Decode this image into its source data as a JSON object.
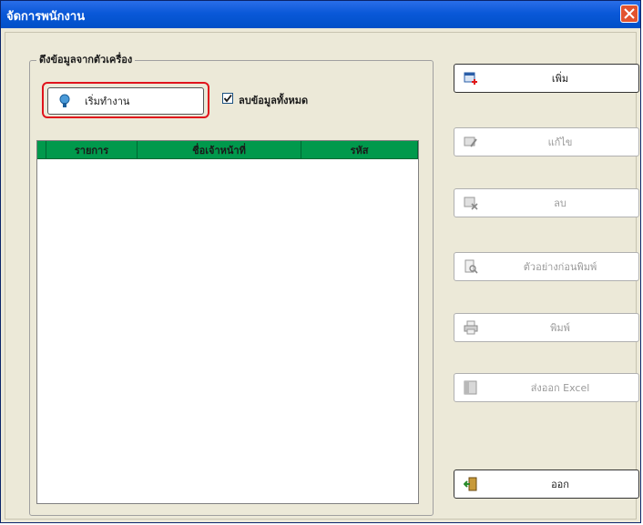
{
  "window": {
    "title": "จัดการพนักงาน"
  },
  "group": {
    "title": "ดึงข้อมูลจากตัวเครื่อง"
  },
  "start_button": {
    "label": "เริ่มทำงาน",
    "icon": "gear-icon"
  },
  "delete_all": {
    "label": "ลบข้อมูลทั้งหมด",
    "checked": true
  },
  "table": {
    "columns": [
      "รายการ",
      "ชื่อเจ้าหน้าที่",
      "รหัส"
    ]
  },
  "side_buttons": [
    {
      "label": "เพิ่ม",
      "icon": "add-record-icon",
      "enabled": true
    },
    {
      "label": "แก้ไข",
      "icon": "edit-record-icon",
      "enabled": false
    },
    {
      "label": "ลบ",
      "icon": "delete-record-icon",
      "enabled": false
    },
    {
      "label": "ตัวอย่างก่อนพิมพ์",
      "icon": "print-preview-icon",
      "enabled": false
    },
    {
      "label": "พิมพ์",
      "icon": "printer-icon",
      "enabled": false
    },
    {
      "label": "ส่งออก Excel",
      "icon": "excel-export-icon",
      "enabled": false
    },
    {
      "label": "ออก",
      "icon": "exit-door-icon",
      "enabled": true
    }
  ],
  "colors": {
    "titlebar": "#0a58d8",
    "header": "#00994c",
    "highlight": "#e0141c",
    "close": "#e2532f"
  }
}
